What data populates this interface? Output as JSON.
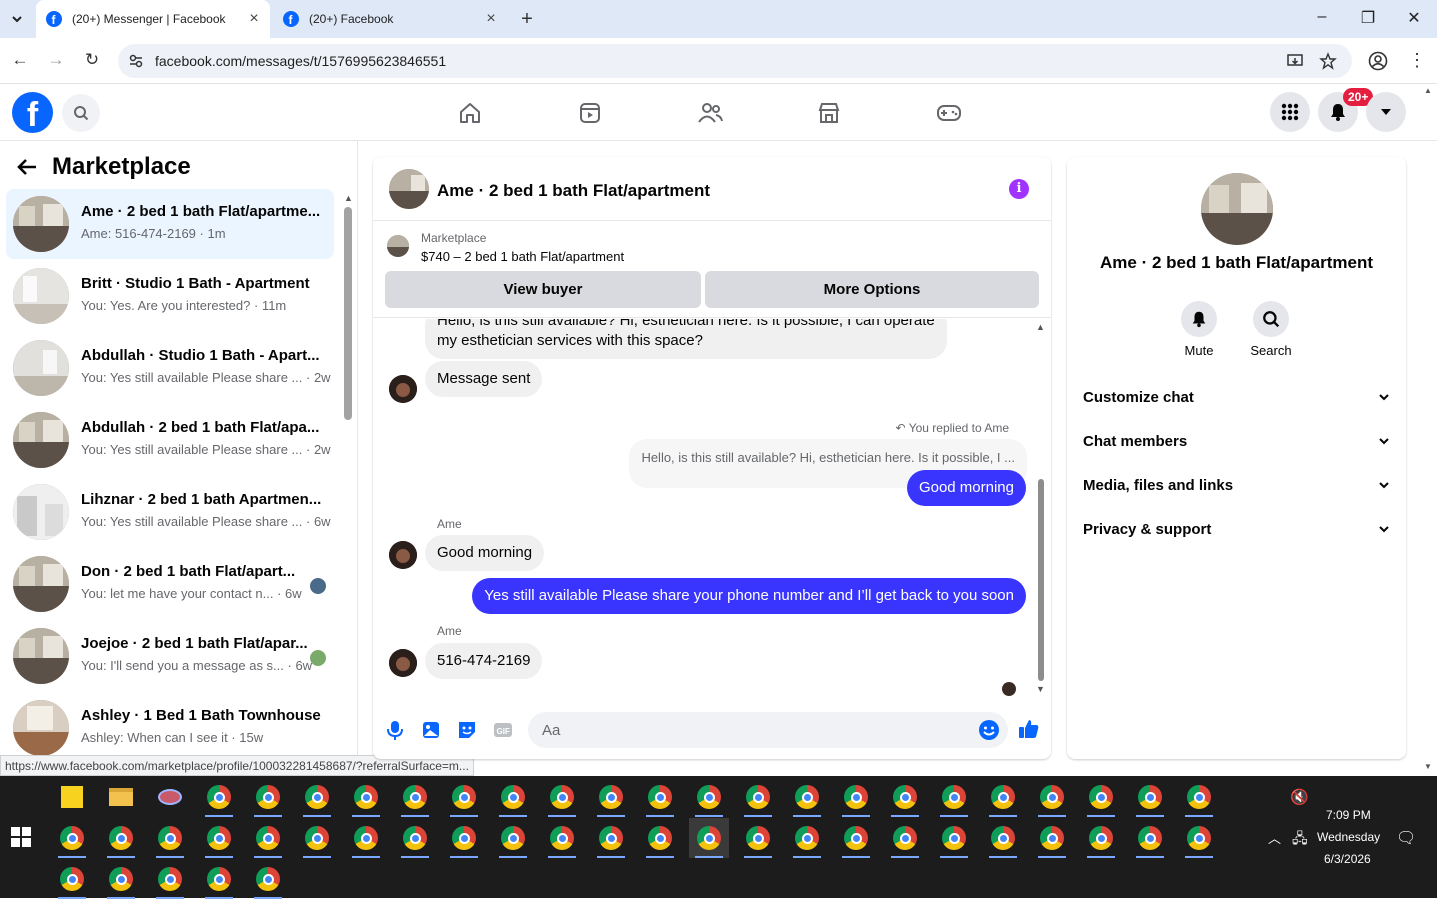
{
  "browser": {
    "tabs": [
      {
        "title": "(20+) Messenger | Facebook",
        "active": true
      },
      {
        "title": "(20+) Facebook",
        "active": false
      }
    ],
    "url": "facebook.com/messages/t/1576995623846551",
    "status_url": "https://www.facebook.com/marketplace/profile/100032281458687/?referralSurface=m..."
  },
  "fb_header": {
    "logo": "f",
    "nav_icons": [
      "home-icon",
      "video-icon",
      "friends-icon",
      "marketplace-icon",
      "gaming-icon"
    ],
    "notification_badge": "20+"
  },
  "left_panel": {
    "title": "Marketplace",
    "conversations": [
      {
        "name": "Ame · 2 bed 1 bath Flat/apartme...",
        "preview": "Ame: 516-474-2169 · 1m",
        "selected": true
      },
      {
        "name": "Britt · Studio 1 Bath - Apartment",
        "preview": "You: Yes. Are you interested? · 11m"
      },
      {
        "name": "Abdullah · Studio 1 Bath - Apart...",
        "preview": "You: Yes still available Please share ... · 2w"
      },
      {
        "name": "Abdullah · 2 bed 1 bath Flat/apa...",
        "preview": "You: Yes still available Please share ... · 2w"
      },
      {
        "name": "Lihznar · 2 bed 1 bath Apartmen...",
        "preview": "You: Yes still available Please share ... · 6w"
      },
      {
        "name": "Don · 2 bed 1 bath Flat/apart...",
        "preview": "You: let me have your contact n... · 6w"
      },
      {
        "name": "Joejoe · 2 bed 1 bath Flat/apar...",
        "preview": "You: I'll send you a message as s... · 6w"
      },
      {
        "name": "Ashley · 1 Bed 1 Bath Townhouse",
        "preview": "Ashley: When can I see it · 15w"
      }
    ]
  },
  "chat": {
    "title": "Ame · 2 bed 1 bath Flat/apartment",
    "listing_label": "Marketplace",
    "listing_price": "$740 – 2 bed 1 bath Flat/apartment",
    "view_buyer": "View buyer",
    "more_options": "More Options",
    "messages": {
      "m1": "Hello, is this still available? Hi, esthetician here. Is it possible, I can operate",
      "m1b": "my esthetician services with this space?",
      "m2": "Message sent",
      "replied_label": "You replied to Ame",
      "reply_quote": "Hello, is this still available? Hi, esthetician here. Is it possible, I ...",
      "m3": "Good morning",
      "sender1": "Ame",
      "m4": "Good morning",
      "m5": "Yes still available Please share your phone number and I’ll get back to you soon",
      "sender2": "Ame",
      "m6": "516-474-2169"
    },
    "composer_placeholder": "Aa"
  },
  "right_panel": {
    "name": "Ame · 2 bed 1 bath Flat/apartment",
    "mute": "Mute",
    "search": "Search",
    "sections": [
      "Customize chat",
      "Chat members",
      "Media, files and links",
      "Privacy & support"
    ]
  },
  "taskbar": {
    "time": "7:09 PM",
    "day": "Wednesday",
    "date": "6/3/2026"
  },
  "colors": {
    "fb_blue": "#0866ff",
    "outgoing_bubble": "#3935ff",
    "notif_red": "#e41e3f",
    "selected_row": "#ebf5ff"
  }
}
